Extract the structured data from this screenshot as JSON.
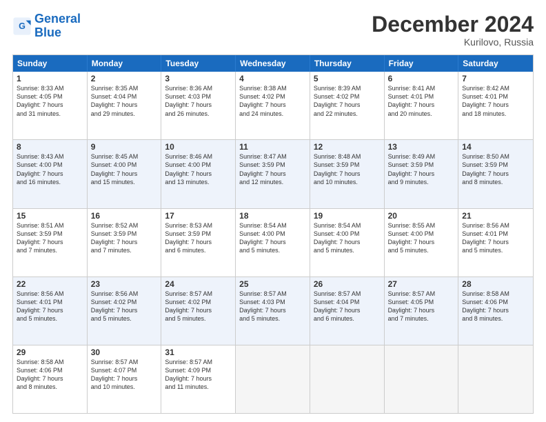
{
  "header": {
    "logo_line1": "General",
    "logo_line2": "Blue",
    "month_title": "December 2024",
    "location": "Kurilovo, Russia"
  },
  "days_of_week": [
    "Sunday",
    "Monday",
    "Tuesday",
    "Wednesday",
    "Thursday",
    "Friday",
    "Saturday"
  ],
  "rows": [
    [
      {
        "num": "1",
        "lines": [
          "Sunrise: 8:33 AM",
          "Sunset: 4:05 PM",
          "Daylight: 7 hours",
          "and 31 minutes."
        ]
      },
      {
        "num": "2",
        "lines": [
          "Sunrise: 8:35 AM",
          "Sunset: 4:04 PM",
          "Daylight: 7 hours",
          "and 29 minutes."
        ]
      },
      {
        "num": "3",
        "lines": [
          "Sunrise: 8:36 AM",
          "Sunset: 4:03 PM",
          "Daylight: 7 hours",
          "and 26 minutes."
        ]
      },
      {
        "num": "4",
        "lines": [
          "Sunrise: 8:38 AM",
          "Sunset: 4:02 PM",
          "Daylight: 7 hours",
          "and 24 minutes."
        ]
      },
      {
        "num": "5",
        "lines": [
          "Sunrise: 8:39 AM",
          "Sunset: 4:02 PM",
          "Daylight: 7 hours",
          "and 22 minutes."
        ]
      },
      {
        "num": "6",
        "lines": [
          "Sunrise: 8:41 AM",
          "Sunset: 4:01 PM",
          "Daylight: 7 hours",
          "and 20 minutes."
        ]
      },
      {
        "num": "7",
        "lines": [
          "Sunrise: 8:42 AM",
          "Sunset: 4:01 PM",
          "Daylight: 7 hours",
          "and 18 minutes."
        ]
      }
    ],
    [
      {
        "num": "8",
        "lines": [
          "Sunrise: 8:43 AM",
          "Sunset: 4:00 PM",
          "Daylight: 7 hours",
          "and 16 minutes."
        ]
      },
      {
        "num": "9",
        "lines": [
          "Sunrise: 8:45 AM",
          "Sunset: 4:00 PM",
          "Daylight: 7 hours",
          "and 15 minutes."
        ]
      },
      {
        "num": "10",
        "lines": [
          "Sunrise: 8:46 AM",
          "Sunset: 4:00 PM",
          "Daylight: 7 hours",
          "and 13 minutes."
        ]
      },
      {
        "num": "11",
        "lines": [
          "Sunrise: 8:47 AM",
          "Sunset: 3:59 PM",
          "Daylight: 7 hours",
          "and 12 minutes."
        ]
      },
      {
        "num": "12",
        "lines": [
          "Sunrise: 8:48 AM",
          "Sunset: 3:59 PM",
          "Daylight: 7 hours",
          "and 10 minutes."
        ]
      },
      {
        "num": "13",
        "lines": [
          "Sunrise: 8:49 AM",
          "Sunset: 3:59 PM",
          "Daylight: 7 hours",
          "and 9 minutes."
        ]
      },
      {
        "num": "14",
        "lines": [
          "Sunrise: 8:50 AM",
          "Sunset: 3:59 PM",
          "Daylight: 7 hours",
          "and 8 minutes."
        ]
      }
    ],
    [
      {
        "num": "15",
        "lines": [
          "Sunrise: 8:51 AM",
          "Sunset: 3:59 PM",
          "Daylight: 7 hours",
          "and 7 minutes."
        ]
      },
      {
        "num": "16",
        "lines": [
          "Sunrise: 8:52 AM",
          "Sunset: 3:59 PM",
          "Daylight: 7 hours",
          "and 7 minutes."
        ]
      },
      {
        "num": "17",
        "lines": [
          "Sunrise: 8:53 AM",
          "Sunset: 3:59 PM",
          "Daylight: 7 hours",
          "and 6 minutes."
        ]
      },
      {
        "num": "18",
        "lines": [
          "Sunrise: 8:54 AM",
          "Sunset: 4:00 PM",
          "Daylight: 7 hours",
          "and 5 minutes."
        ]
      },
      {
        "num": "19",
        "lines": [
          "Sunrise: 8:54 AM",
          "Sunset: 4:00 PM",
          "Daylight: 7 hours",
          "and 5 minutes."
        ]
      },
      {
        "num": "20",
        "lines": [
          "Sunrise: 8:55 AM",
          "Sunset: 4:00 PM",
          "Daylight: 7 hours",
          "and 5 minutes."
        ]
      },
      {
        "num": "21",
        "lines": [
          "Sunrise: 8:56 AM",
          "Sunset: 4:01 PM",
          "Daylight: 7 hours",
          "and 5 minutes."
        ]
      }
    ],
    [
      {
        "num": "22",
        "lines": [
          "Sunrise: 8:56 AM",
          "Sunset: 4:01 PM",
          "Daylight: 7 hours",
          "and 5 minutes."
        ]
      },
      {
        "num": "23",
        "lines": [
          "Sunrise: 8:56 AM",
          "Sunset: 4:02 PM",
          "Daylight: 7 hours",
          "and 5 minutes."
        ]
      },
      {
        "num": "24",
        "lines": [
          "Sunrise: 8:57 AM",
          "Sunset: 4:02 PM",
          "Daylight: 7 hours",
          "and 5 minutes."
        ]
      },
      {
        "num": "25",
        "lines": [
          "Sunrise: 8:57 AM",
          "Sunset: 4:03 PM",
          "Daylight: 7 hours",
          "and 5 minutes."
        ]
      },
      {
        "num": "26",
        "lines": [
          "Sunrise: 8:57 AM",
          "Sunset: 4:04 PM",
          "Daylight: 7 hours",
          "and 6 minutes."
        ]
      },
      {
        "num": "27",
        "lines": [
          "Sunrise: 8:57 AM",
          "Sunset: 4:05 PM",
          "Daylight: 7 hours",
          "and 7 minutes."
        ]
      },
      {
        "num": "28",
        "lines": [
          "Sunrise: 8:58 AM",
          "Sunset: 4:06 PM",
          "Daylight: 7 hours",
          "and 8 minutes."
        ]
      }
    ],
    [
      {
        "num": "29",
        "lines": [
          "Sunrise: 8:58 AM",
          "Sunset: 4:06 PM",
          "Daylight: 7 hours",
          "and 8 minutes."
        ]
      },
      {
        "num": "30",
        "lines": [
          "Sunrise: 8:57 AM",
          "Sunset: 4:07 PM",
          "Daylight: 7 hours",
          "and 10 minutes."
        ]
      },
      {
        "num": "31",
        "lines": [
          "Sunrise: 8:57 AM",
          "Sunset: 4:09 PM",
          "Daylight: 7 hours",
          "and 11 minutes."
        ]
      },
      {
        "num": "",
        "lines": []
      },
      {
        "num": "",
        "lines": []
      },
      {
        "num": "",
        "lines": []
      },
      {
        "num": "",
        "lines": []
      }
    ]
  ]
}
